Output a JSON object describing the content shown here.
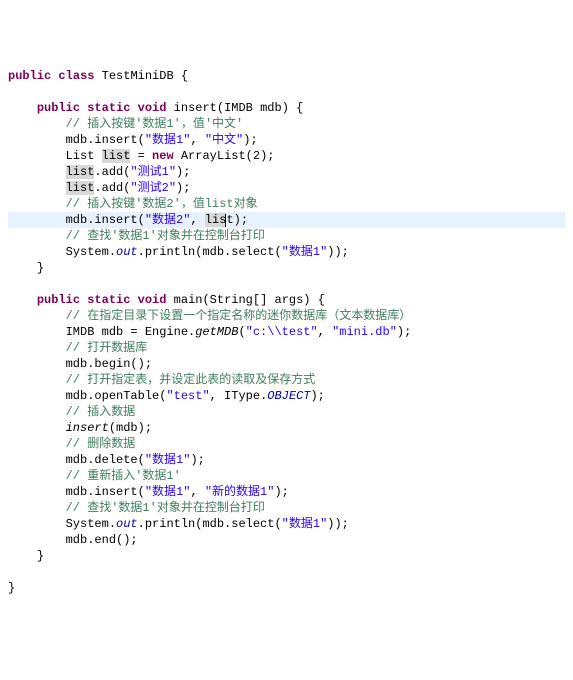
{
  "lines": {
    "l0_kw1": "public",
    "l0_kw2": "class",
    "l0_name": "TestMiniDB {",
    "l1_kw1": "public",
    "l1_kw2": "static",
    "l1_kw3": "void",
    "l1_name": "insert(IMDB mdb) {",
    "l2_cm": "// 插入按键'数据1'，值'中文'",
    "l3a": "mdb.insert(",
    "l3s1": "\"数据1\"",
    "l3b": ", ",
    "l3s2": "\"中文\"",
    "l3c": ");",
    "l4a": "List ",
    "l4hl": "list",
    "l4b": " = ",
    "l4kw": "new",
    "l4c": " ArrayList(2);",
    "l5hl": "list",
    "l5a": ".add(",
    "l5s": "\"测试1\"",
    "l5b": ");",
    "l6hl": "list",
    "l6a": ".add(",
    "l6s": "\"测试2\"",
    "l6b": ");",
    "l7_cm": "// 插入按键'数据2'，值list对象",
    "l8a": "mdb.insert(",
    "l8s": "\"数据2\"",
    "l8b": ", ",
    "l8hl": "lis",
    "l8c": ");",
    "l9_cm": "// 查找'数据1'对象并在控制台打印",
    "l10a": "System.",
    "l10f": "out",
    "l10b": ".println(mdb.select(",
    "l10s": "\"数据1\"",
    "l10c": "));",
    "l11": "}",
    "l12_kw1": "public",
    "l12_kw2": "static",
    "l12_kw3": "void",
    "l12_name": "main(String[] args) {",
    "l13_cm": "// 在指定目录下设置一个指定名称的迷你数据库（文本数据库）",
    "l14a": "IMDB mdb = Engine.",
    "l14m": "getMDB",
    "l14b": "(",
    "l14s1": "\"c:\\\\test\"",
    "l14c": ", ",
    "l14s2": "\"mini.db\"",
    "l14d": ");",
    "l15_cm": "// 打开数据库",
    "l16": "mdb.begin();",
    "l17_cm": "// 打开指定表，并设定此表的读取及保存方式",
    "l18a": "mdb.openTable(",
    "l18s": "\"test\"",
    "l18b": ", IType.",
    "l18f": "OBJECT",
    "l18c": ");",
    "l19_cm": "// 插入数据",
    "l20m": "insert",
    "l20a": "(mdb);",
    "l21_cm": "// 删除数据",
    "l22a": "mdb.delete(",
    "l22s": "\"数据1\"",
    "l22b": ");",
    "l23_cm": "// 重新插入'数据1'",
    "l24a": "mdb.insert(",
    "l24s1": "\"数据1\"",
    "l24b": ", ",
    "l24s2": "\"新的数据1\"",
    "l24c": ");",
    "l25_cm": "// 查找'数据1'对象并在控制台打印",
    "l26a": "System.",
    "l26f": "out",
    "l26b": ".println(mdb.select(",
    "l26s": "\"数据1\"",
    "l26c": "));",
    "l27": "mdb.end();",
    "l28": "}",
    "l29": "}"
  },
  "indent1": "    ",
  "indent2": "        "
}
